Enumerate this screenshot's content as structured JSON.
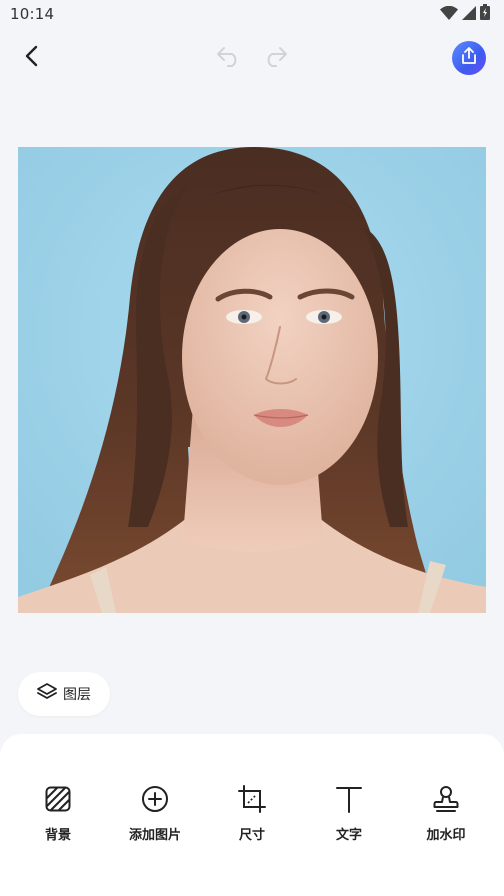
{
  "status_bar": {
    "time": "10:14"
  },
  "toolbar": {
    "back_icon": "chevron-left-icon",
    "undo_icon": "undo-icon",
    "redo_icon": "redo-icon",
    "share_icon": "share-icon",
    "share_color": "#4a6cf7"
  },
  "canvas": {
    "background_color": "#a3d5ea",
    "content": "portrait-photo"
  },
  "layers": {
    "label": "图层",
    "icon": "layers-icon"
  },
  "tools": [
    {
      "label": "背景",
      "icon": "background-pattern-icon"
    },
    {
      "label": "添加图片",
      "icon": "add-circle-icon"
    },
    {
      "label": "尺寸",
      "icon": "crop-resize-icon"
    },
    {
      "label": "文字",
      "icon": "text-icon"
    },
    {
      "label": "加水印",
      "icon": "stamp-icon"
    }
  ]
}
